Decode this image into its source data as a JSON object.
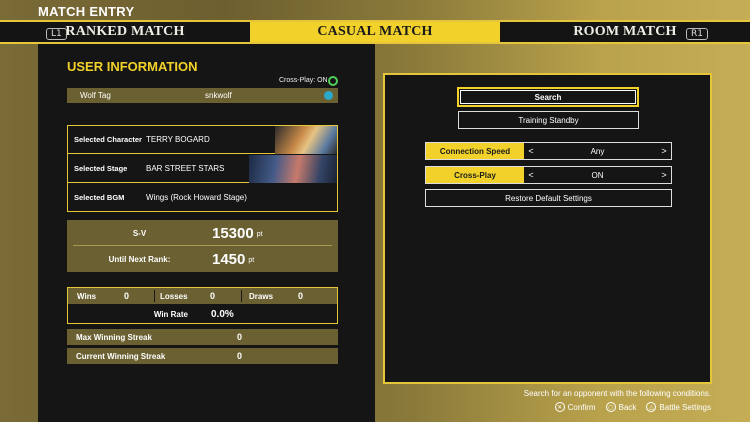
{
  "window_title": "MATCH ENTRY",
  "tabs": [
    {
      "label": "RANKED MATCH"
    },
    {
      "label": "CASUAL MATCH"
    },
    {
      "label": "ROOM MATCH"
    }
  ],
  "tab_hints": {
    "left": "L1",
    "right": "R1"
  },
  "user_info": {
    "title": "USER INFORMATION",
    "crossplay_status": "Cross-Play: ON",
    "wolf_tag_label": "Wolf Tag",
    "wolf_tag_value": "snkwolf",
    "selections": [
      {
        "label": "Selected Character",
        "value": "TERRY BOGARD"
      },
      {
        "label": "Selected Stage",
        "value": "BAR STREET STARS"
      },
      {
        "label": "Selected BGM",
        "value": "Wings (Rock Howard Stage)"
      }
    ],
    "sv_label": "S-V",
    "sv_value": "15300",
    "sv_unit": "pt",
    "next_rank_label": "Until Next Rank:",
    "next_rank_value": "1450",
    "next_rank_unit": "pt",
    "wins_label": "Wins",
    "wins_value": "0",
    "losses_label": "Losses",
    "losses_value": "0",
    "draws_label": "Draws",
    "draws_value": "0",
    "win_rate_label": "Win Rate",
    "win_rate_value": "0.0%",
    "max_streak_label": "Max Winning Streak",
    "max_streak_value": "0",
    "current_streak_label": "Current Winning Streak",
    "current_streak_value": "0"
  },
  "search_panel": {
    "search_label": "Search",
    "training_label": "Training Standby",
    "connection_speed_label": "Connection Speed",
    "connection_speed_value": "Any",
    "crossplay_label": "Cross-Play",
    "crossplay_value": "ON",
    "restore_label": "Restore Default Settings",
    "arrow_left": "<",
    "arrow_right": ">"
  },
  "footer": {
    "description": "Search for an opponent with the following conditions.",
    "confirm_label": "Confirm",
    "back_label": "Back",
    "battle_settings_label": "Battle Settings"
  },
  "colors": {
    "accent": "#f2d22a",
    "panel": "#151515",
    "row_bg": "#6a6032",
    "online": "#4fcf5a"
  }
}
